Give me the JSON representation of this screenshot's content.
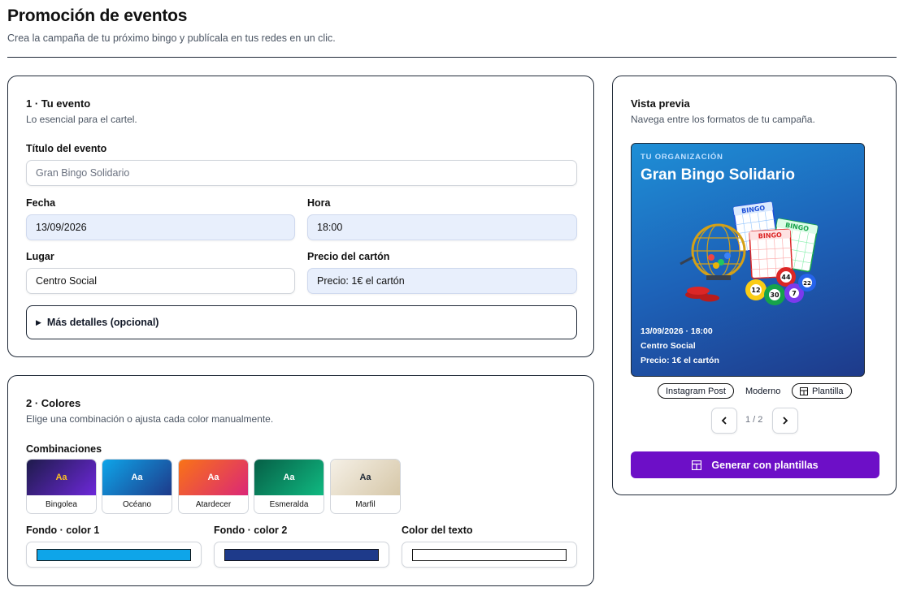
{
  "header": {
    "title": "Promoción de eventos",
    "subtitle": "Crea la campaña de tu próximo bingo y publícala en tus redes en un clic."
  },
  "event": {
    "section_title": "1 · Tu evento",
    "section_desc": "Lo esencial para el cartel.",
    "title_label": "Título del evento",
    "title_placeholder": "Gran Bingo Solidario",
    "date_label": "Fecha",
    "date_value": "13/09/2026",
    "time_label": "Hora",
    "time_value": "18:00",
    "place_label": "Lugar",
    "place_value": "Centro Social",
    "price_label": "Precio del cartón",
    "price_value": "Precio: 1€ el cartón",
    "more_details": "Más detalles (opcional)"
  },
  "colors": {
    "section_title": "2 · Colores",
    "section_desc": "Elige una combinación o ajusta cada color manualmente.",
    "combos_label": "Combinaciones",
    "combos": [
      {
        "name": "Bingolea",
        "sample": "Aa",
        "from": "#1e1b4b",
        "to": "#6d28d9",
        "text": "#fbbf24"
      },
      {
        "name": "Océano",
        "sample": "Aa",
        "from": "#0ea5e9",
        "to": "#1e3a8a",
        "text": "#ffffff"
      },
      {
        "name": "Atardecer",
        "sample": "Aa",
        "from": "#f97316",
        "to": "#db2777",
        "text": "#ffffff"
      },
      {
        "name": "Esmeralda",
        "sample": "Aa",
        "from": "#065f46",
        "to": "#10b981",
        "text": "#ffffff"
      },
      {
        "name": "Marfil",
        "sample": "Aa",
        "from": "#f5f0e6",
        "to": "#d6c7a8",
        "text": "#1f2937"
      }
    ],
    "bg1_label": "Fondo · color 1",
    "bg1_value": "#0ea5e9",
    "bg2_label": "Fondo · color 2",
    "bg2_value": "#1e3a8a",
    "text_label": "Color del texto",
    "text_value": "#ffffff"
  },
  "preview": {
    "title": "Vista previa",
    "desc": "Navega entre los formatos de tu campaña.",
    "poster": {
      "org": "TU ORGANIZACIÓN",
      "title": "Gran Bingo Solidario",
      "datetime": "13/09/2026 · 18:00",
      "place": "Centro Social",
      "price": "Precio: 1€ el cartón"
    },
    "format_pill": "Instagram Post",
    "style_pill": "Moderno",
    "template_pill": "Plantilla",
    "pager": "1 / 2",
    "generate_button": "Generar con plantillas"
  }
}
